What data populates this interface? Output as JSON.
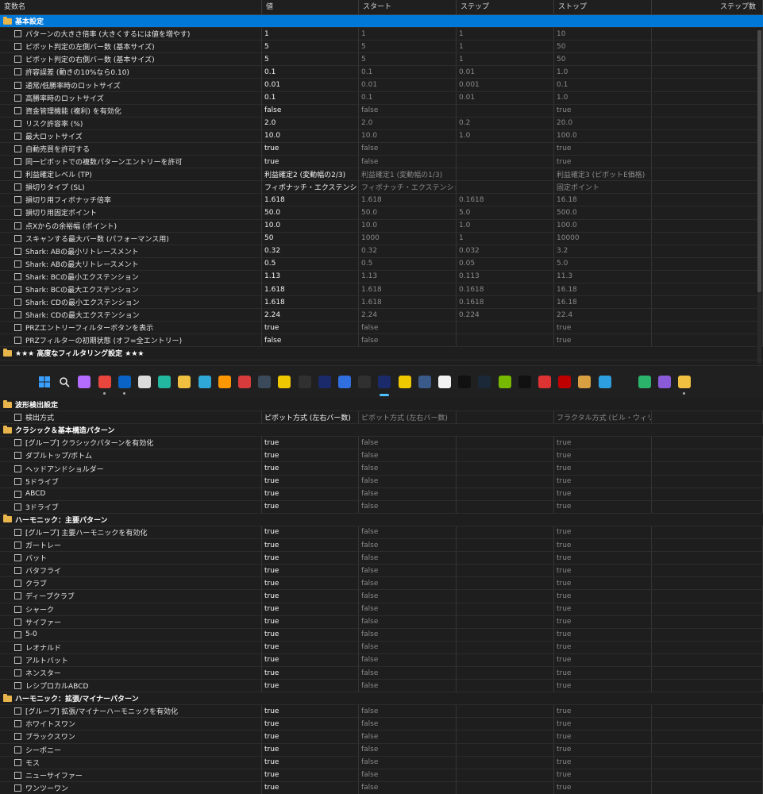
{
  "columns": [
    "変数名",
    "値",
    "スタート",
    "ステップ",
    "ストップ",
    "ステップ数"
  ],
  "top_sections": [
    {
      "group": "基本設定",
      "selected": true,
      "rows": [
        [
          "パターンの大きさ倍率 (大きくするには値を増やす)",
          "1",
          "1",
          "1",
          "10"
        ],
        [
          "ピボット判定の左側バー数 (基本サイズ)",
          "5",
          "5",
          "1",
          "50"
        ],
        [
          "ピボット判定の右側バー数 (基本サイズ)",
          "5",
          "5",
          "1",
          "50"
        ],
        [
          "許容誤差 (動きの10%なら0.10)",
          "0.1",
          "0.1",
          "0.01",
          "1.0"
        ],
        [
          "通常/低勝率時のロットサイズ",
          "0.01",
          "0.01",
          "0.001",
          "0.1"
        ],
        [
          "高勝率時のロットサイズ",
          "0.1",
          "0.1",
          "0.01",
          "1.0"
        ],
        [
          "資金管理機能 (複利) を有効化",
          "false",
          "false",
          "",
          "true"
        ],
        [
          "リスク許容率 (%)",
          "2.0",
          "2.0",
          "0.2",
          "20.0"
        ],
        [
          "最大ロットサイズ",
          "10.0",
          "10.0",
          "1.0",
          "100.0"
        ],
        [
          "自動売買を許可する",
          "true",
          "false",
          "",
          "true"
        ],
        [
          "同一ピボットでの複数パターンエントリーを許可",
          "true",
          "false",
          "",
          "true"
        ],
        [
          "利益確定レベル (TP)",
          "利益確定2 (変動幅の2/3)",
          "利益確定1 (変動幅の1/3)",
          "",
          "利益確定3 (ピボットE価格)"
        ],
        [
          "損切りタイプ (SL)",
          "フィボナッチ・エクステンション",
          "フィボナッチ・エクステンション",
          "",
          "固定ポイント"
        ],
        [
          "損切り用フィボナッチ倍率",
          "1.618",
          "1.618",
          "0.1618",
          "16.18"
        ],
        [
          "損切り用固定ポイント",
          "50.0",
          "50.0",
          "5.0",
          "500.0"
        ],
        [
          "点Xからの余裕幅 (ポイント)",
          "10.0",
          "10.0",
          "1.0",
          "100.0"
        ],
        [
          "スキャンする最大バー数 (パフォーマンス用)",
          "50",
          "1000",
          "1",
          "10000"
        ],
        [
          "Shark: ABの最小リトレースメント",
          "0.32",
          "0.32",
          "0.032",
          "3.2"
        ],
        [
          "Shark: ABの最大リトレースメント",
          "0.5",
          "0.5",
          "0.05",
          "5.0"
        ],
        [
          "Shark: BCの最小エクステンション",
          "1.13",
          "1.13",
          "0.113",
          "11.3"
        ],
        [
          "Shark: BCの最大エクステンション",
          "1.618",
          "1.618",
          "0.1618",
          "16.18"
        ],
        [
          "Shark: CDの最小エクステンション",
          "1.618",
          "1.618",
          "0.1618",
          "16.18"
        ],
        [
          "Shark: CDの最大エクステンション",
          "2.24",
          "2.24",
          "0.224",
          "22.4"
        ],
        [
          "PRZエントリーフィルターボタンを表示",
          "true",
          "false",
          "",
          "true"
        ],
        [
          "PRZフィルターの初期状態 (オフ=全エントリー)",
          "false",
          "false",
          "",
          "true"
        ]
      ]
    },
    {
      "group": "★★★ 高度なフィルタリング設定 ★★★",
      "selected": false,
      "rows": []
    }
  ],
  "bottom_sections": [
    {
      "group": "波形検出設定",
      "rows": [
        [
          "検出方式",
          "ピボット方式 (左右バー数)",
          "ピボット方式 (左右バー数)",
          "",
          "フラクタル方式 (ビル・ウィリア..."
        ]
      ]
    },
    {
      "group": "クラシック＆基本構造パターン",
      "rows": [
        [
          "[グループ] クラシックパターンを有効化",
          "true",
          "false",
          "",
          "true"
        ],
        [
          "ダブルトップ/ボトム",
          "true",
          "false",
          "",
          "true"
        ],
        [
          "ヘッドアンドショルダー",
          "true",
          "false",
          "",
          "true"
        ],
        [
          "5ドライブ",
          "true",
          "false",
          "",
          "true"
        ],
        [
          "ABCD",
          "true",
          "false",
          "",
          "true"
        ],
        [
          "3ドライブ",
          "true",
          "false",
          "",
          "true"
        ]
      ]
    },
    {
      "group": "ハーモニック：主要パターン",
      "rows": [
        [
          "[グループ] 主要ハーモニックを有効化",
          "true",
          "false",
          "",
          "true"
        ],
        [
          "ガートレー",
          "true",
          "false",
          "",
          "true"
        ],
        [
          "バット",
          "true",
          "false",
          "",
          "true"
        ],
        [
          "バタフライ",
          "true",
          "false",
          "",
          "true"
        ],
        [
          "クラブ",
          "true",
          "false",
          "",
          "true"
        ],
        [
          "ディープクラブ",
          "true",
          "false",
          "",
          "true"
        ],
        [
          "シャーク",
          "true",
          "false",
          "",
          "true"
        ],
        [
          "サイファー",
          "true",
          "false",
          "",
          "true"
        ],
        [
          "5-0",
          "true",
          "false",
          "",
          "true"
        ],
        [
          "レオナルド",
          "true",
          "false",
          "",
          "true"
        ],
        [
          "アルトバット",
          "true",
          "false",
          "",
          "true"
        ],
        [
          "ネンスター",
          "true",
          "false",
          "",
          "true"
        ],
        [
          "レシプロカルABCD",
          "true",
          "false",
          "",
          "true"
        ]
      ]
    },
    {
      "group": "ハーモニック：拡張/マイナーパターン",
      "rows": [
        [
          "[グループ] 拡張/マイナーハーモニックを有効化",
          "true",
          "false",
          "",
          "true"
        ],
        [
          "ホワイトスワン",
          "true",
          "false",
          "",
          "true"
        ],
        [
          "ブラックスワン",
          "true",
          "false",
          "",
          "true"
        ],
        [
          "シーポニー",
          "true",
          "false",
          "",
          "true"
        ],
        [
          "モス",
          "true",
          "false",
          "",
          "true"
        ],
        [
          "ニューサイファー",
          "true",
          "false",
          "",
          "true"
        ],
        [
          "ワンツーワン",
          "true",
          "false",
          "",
          "true"
        ]
      ]
    }
  ],
  "taskbar": {
    "icons": [
      {
        "name": "windows-start-icon",
        "label": "",
        "color": "#3aa0ff"
      },
      {
        "name": "search-icon",
        "label": "",
        "color": "#202020"
      },
      {
        "name": "copilot-icon",
        "label": "",
        "color": "#b46cff"
      },
      {
        "name": "chrome-icon",
        "label": "",
        "color": "#e8453c"
      },
      {
        "name": "outlook-icon",
        "label": "",
        "color": "#0a64c8"
      },
      {
        "name": "notepad-icon",
        "label": "",
        "color": "#dcdcdc"
      },
      {
        "name": "cube-app-icon",
        "label": "",
        "color": "#22b8a0"
      },
      {
        "name": "file-explorer-icon",
        "label": "",
        "color": "#f0c040"
      },
      {
        "name": "edge-icon",
        "label": "",
        "color": "#2fa8d8"
      },
      {
        "name": "sublime-text-icon",
        "label": "",
        "color": "#ff9800"
      },
      {
        "name": "red-app-icon",
        "label": "",
        "color": "#d83b3b"
      },
      {
        "name": "chatgpt-icon",
        "label": "",
        "color": "#3a4a5a"
      },
      {
        "name": "mt-yellow-icon",
        "label": "",
        "color": "#f0c800"
      },
      {
        "name": "x-app-icon",
        "label": "",
        "color": "#303030"
      },
      {
        "name": "mt5-icon",
        "label": "",
        "color": "#1a2a6a"
      },
      {
        "name": "arrow-app-icon",
        "label": "",
        "color": "#2f6fe0"
      },
      {
        "name": "x-app-2-icon",
        "label": "",
        "color": "#303030"
      },
      {
        "name": "mt5-active-icon",
        "label": "",
        "color": "#1a2a6a"
      },
      {
        "name": "mt-yellow-2-icon",
        "label": "",
        "color": "#f0c800"
      },
      {
        "name": "check-app-icon",
        "label": "",
        "color": "#3a5a8a"
      },
      {
        "name": "doc-app-icon",
        "label": "",
        "color": "#f2f2f2"
      },
      {
        "name": "dark-app-icon",
        "label": "",
        "color": "#111111"
      },
      {
        "name": "steam-icon",
        "label": "",
        "color": "#1b2838"
      },
      {
        "name": "nvidia-icon",
        "label": "",
        "color": "#76b900"
      },
      {
        "name": "epic-games-icon",
        "label": "",
        "color": "#111111"
      },
      {
        "name": "cards-app-icon",
        "label": "",
        "color": "#dd3333"
      },
      {
        "name": "filezilla-icon",
        "label": "",
        "color": "#bf0000"
      },
      {
        "name": "image-app-icon",
        "label": "",
        "color": "#d8a040"
      },
      {
        "name": "vscode-icon",
        "label": "",
        "color": "#2d9ee0"
      },
      {
        "name": "a-app-icon",
        "label": "",
        "color": "#202020"
      },
      {
        "name": "green-app-icon",
        "label": "",
        "color": "#2bb36b"
      },
      {
        "name": "visual-studio-icon",
        "label": "",
        "color": "#8a5ad8"
      },
      {
        "name": "notes-app-icon",
        "label": "",
        "color": "#f0c040"
      }
    ]
  }
}
